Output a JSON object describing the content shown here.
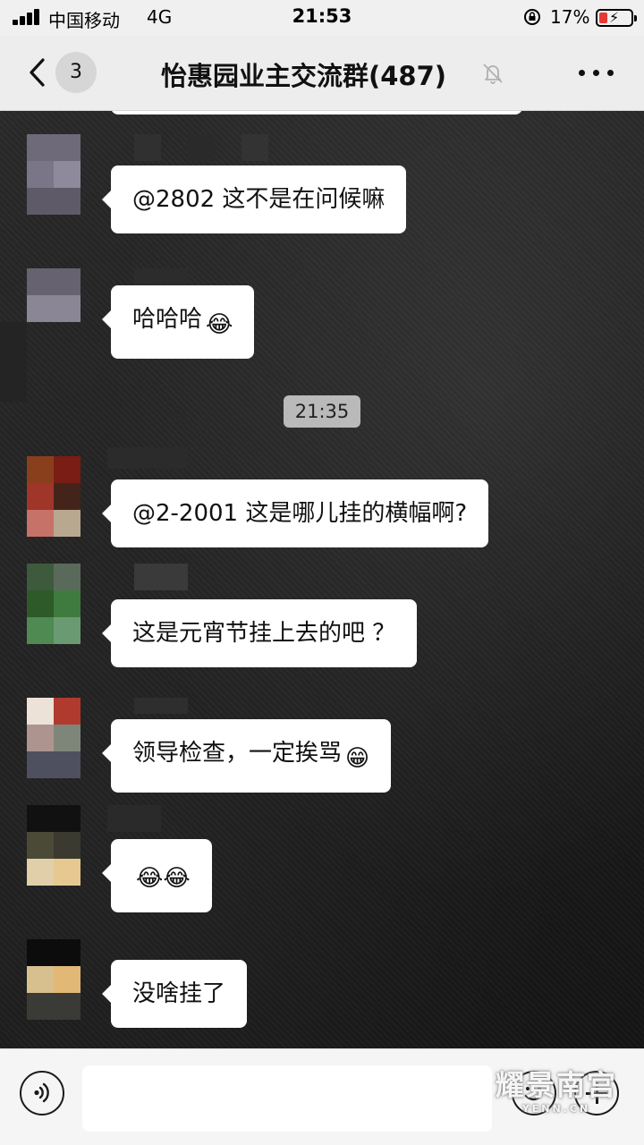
{
  "status_bar": {
    "carrier": "中国移动",
    "network": "4G",
    "time": "21:53",
    "battery_percent": "17%",
    "battery_level": 0.17,
    "battery_color": "#e53935"
  },
  "nav": {
    "unread_count": "3",
    "title": "怡惠园业主交流群(487)",
    "icons": [
      "back-chevron-icon",
      "mute-bell-icon",
      "more-dots-icon"
    ]
  },
  "messages": [
    {
      "text": "@2802 这不是在问候嘛",
      "emoji": ""
    },
    {
      "text": "哈哈哈",
      "emoji": "😂"
    },
    {
      "text": "@2-2001 这是哪儿挂的横幅啊?",
      "emoji": ""
    },
    {
      "text": "这是元宵节挂上去的吧 ？",
      "emoji": ""
    },
    {
      "text": "领导检查，一定挨骂",
      "emoji": "😁"
    },
    {
      "text": "",
      "emoji": "😂😂"
    },
    {
      "text": "没啥挂了",
      "emoji": ""
    }
  ],
  "timestamp": "21:35",
  "input_bar": {
    "placeholder": "",
    "icons": [
      "voice-icon",
      "emoji-icon",
      "plus-icon"
    ]
  },
  "watermark": {
    "main": "耀景南宫",
    "sub": "YENN.CN"
  }
}
